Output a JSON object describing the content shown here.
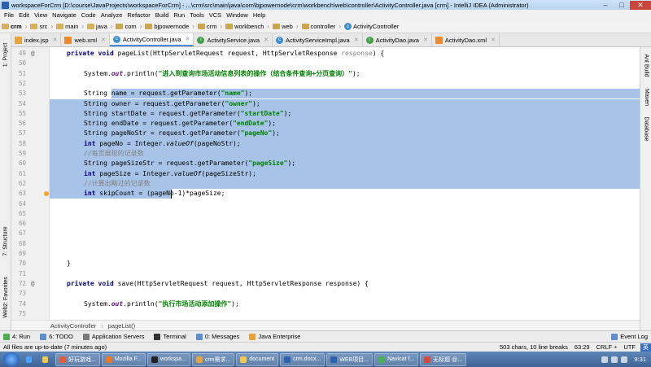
{
  "window": {
    "title": "workspaceForCrm [D:\\course\\JavaProjects\\workspaceForCrm] - ...\\crm\\src\\main\\java\\com\\bjpowernode\\crm\\workbench\\web\\controller\\ActivityController.java [crm] - IntelliJ IDEA (Administrator)",
    "minimize": "–",
    "maximize": "□",
    "close": "✕"
  },
  "menu": [
    "File",
    "Edit",
    "View",
    "Navigate",
    "Code",
    "Analyze",
    "Refactor",
    "Build",
    "Run",
    "Tools",
    "VCS",
    "Window",
    "Help"
  ],
  "breadcrumbs": [
    "crm",
    "src",
    "main",
    "java",
    "com",
    "bjpowernode",
    "crm",
    "workbench",
    "web",
    "controller",
    "ActivityController"
  ],
  "tabs": [
    {
      "label": "index.jsp",
      "icon": "f"
    },
    {
      "label": "web.xml",
      "icon": "x"
    },
    {
      "label": "ActivityController.java",
      "icon": "c",
      "active": true
    },
    {
      "label": "ActivityService.java",
      "icon": "i"
    },
    {
      "label": "ActivityServiceImpl.java",
      "icon": "c"
    },
    {
      "label": "ActivityDao.java",
      "icon": "i"
    },
    {
      "label": "ActivityDao.xml",
      "icon": "x"
    }
  ],
  "left_tool_tabs": {
    "project": "1: Project",
    "structure": "7: Structure",
    "favorites": "2: Favorites",
    "web": "Web"
  },
  "right_tool_tabs": {
    "ant": "Ant Build",
    "maven": "Maven",
    "database": "Database"
  },
  "gutter": {
    "line_numbers": [
      "49",
      "50",
      "51",
      "52",
      "53",
      "54",
      "55",
      "56",
      "57",
      "58",
      "59",
      "60",
      "61",
      "62",
      "63",
      "64",
      "65",
      "66",
      "67",
      "68",
      "69",
      "70",
      "71",
      "72",
      "73",
      "74",
      "75"
    ],
    "marks": {
      "49": "@",
      "72": "@"
    }
  },
  "code": {
    "l49": {
      "kw": "private void ",
      "rest1": "pageList(HttpServletRequest request, HttpServletResponse ",
      "param": "response",
      "rest2": ") {"
    },
    "l51": {
      "a": "System.",
      "f": "out",
      "b": ".println(",
      "s": "\"进入到查询市场活动信息列表的操作（结合条件查询+分页查询）\"",
      "c": ");"
    },
    "l52": {
      "a": "String ",
      "b": "name = request.getParameter(",
      "s": "\"name\"",
      "c": ");"
    },
    "l53": {
      "a": "String owner = request.getParameter(",
      "s": "\"owner\"",
      "c": ");"
    },
    "l54": {
      "a": "String startDate = request.getParameter(",
      "s": "\"startDate\"",
      "c": ");"
    },
    "l55": {
      "a": "String endDate = request.getParameter(",
      "s": "\"endDate\"",
      "c": ");"
    },
    "l56": {
      "a": "String pageNoStr = request.getParameter(",
      "s": "\"pageNo\"",
      "c": ");"
    },
    "l57": {
      "kw": "int ",
      "a": "pageNo = Integer.",
      "i": "valueOf",
      "c": "(pageNoStr);"
    },
    "l58": {
      "cm": "//每页展现的记录数"
    },
    "l59": {
      "a": "String pageSizeStr = request.getParameter(",
      "s": "\"pageSize\"",
      "c": ");"
    },
    "l60": {
      "kw": "int ",
      "a": "pageSize = Integer.",
      "i": "valueOf",
      "c": "(pageSizeStr);"
    },
    "l61": {
      "cm": "//计算出略过的记录数"
    },
    "l62": {
      "kw": "int ",
      "a": "skipCount = (pag",
      "b": "eNo-1)*pageSize;"
    },
    "l69": {
      "a": "}"
    },
    "l71": {
      "kw": "private void ",
      "a": "save(HttpServletRequest request, HttpServletResponse response) {"
    },
    "l73": {
      "a": "System.",
      "f": "out",
      "b": ".println(",
      "s": "\"执行市场活动添加操作\"",
      "c": ");"
    }
  },
  "editor_breadcrumb": [
    "ActivityController",
    "pageList()"
  ],
  "tool_windows": [
    {
      "label": "4: Run",
      "color": "#4caf50"
    },
    {
      "label": "6: TODO",
      "color": "#5a8fd6"
    },
    {
      "label": "Application Servers",
      "color": "#7a7a7a"
    },
    {
      "label": "Terminal",
      "color": "#333333"
    },
    {
      "label": "0: Messages",
      "color": "#5a8fd6"
    },
    {
      "label": "Java Enterprise",
      "color": "#e8a33d"
    }
  ],
  "event_log": "Event Log",
  "status": {
    "message": "All files are up-to-date (7 minutes ago)",
    "chars": "503 chars, 10 line breaks",
    "position": "63:29",
    "line_sep": "CRLF ÷",
    "encoding": "UTF",
    "ime": "英"
  },
  "taskbar": {
    "apps": [
      "好玩游戏...",
      "Mozilla F...",
      "workspa...",
      "crm需求...",
      "document",
      "crm.docx...",
      "WEB项目...",
      "Navicat f...",
      "无标题 @..."
    ],
    "clock": "9:31"
  }
}
